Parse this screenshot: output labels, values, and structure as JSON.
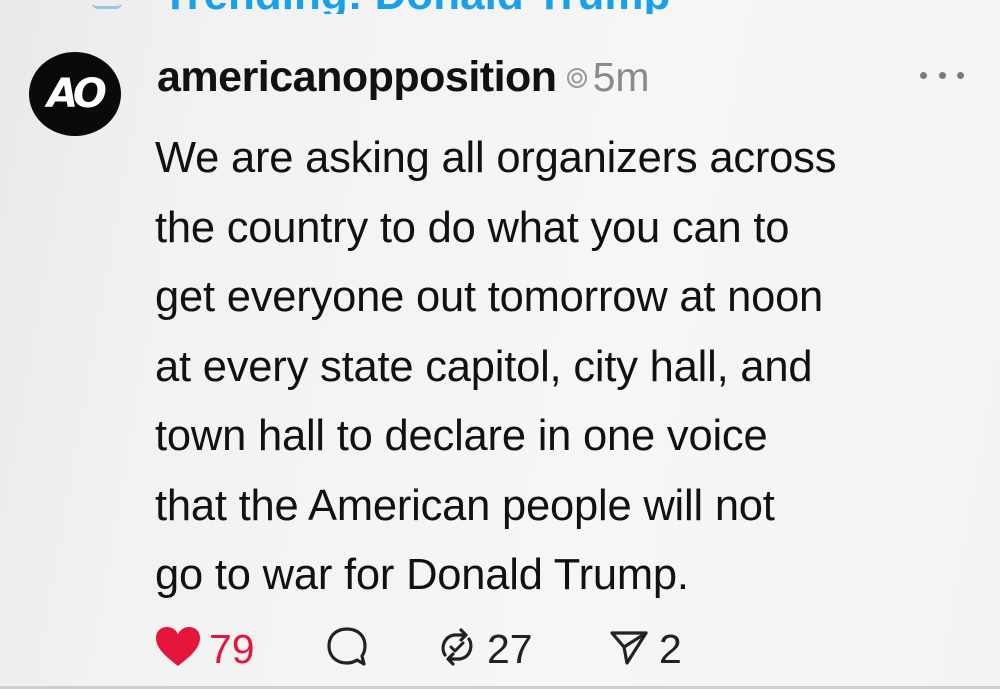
{
  "post": {
    "author": {
      "avatar_text": "AO",
      "username": "americanopposition"
    },
    "timestamp": "5m",
    "text_lines": [
      "We are asking all organizers across",
      "the country to do what you can to",
      "get everyone out tomorrow at noon",
      "at every state capitol, city hall, and",
      "town hall to declare in one voice",
      "that the American people will not",
      "go to war for Donald Trump."
    ],
    "actions": {
      "likes": "79",
      "reposts": "27",
      "shares": "2"
    }
  },
  "icons": {
    "like": "heart-icon",
    "comment": "speech-bubble-icon",
    "repost": "repost-icon",
    "share": "send-icon",
    "more": "more-options-icon",
    "verified": "ring-icon"
  },
  "colors": {
    "like": "#e5163c",
    "trending": "#1aa0e8",
    "muted": "#8a8a8a"
  }
}
